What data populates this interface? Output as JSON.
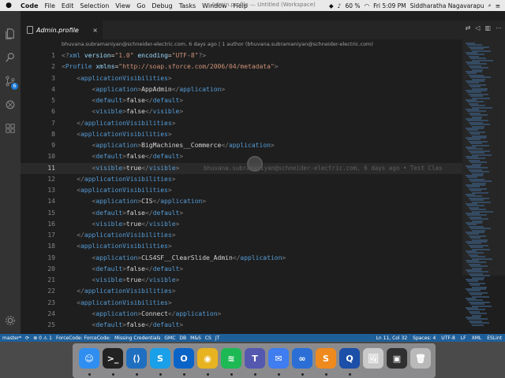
{
  "menubar": {
    "apple_icon": "apple-icon",
    "items": [
      "Code",
      "File",
      "Edit",
      "Selection",
      "View",
      "Go",
      "Debug",
      "Tasks",
      "Window",
      "Help"
    ],
    "window_title": "Admin.profile — Untitled (Workspace)",
    "battery": "60 %",
    "clock": "Fri 5:09 PM",
    "user": "Siddharatha Nagavarapu"
  },
  "activity_bar": {
    "icons": [
      "files-icon",
      "search-icon",
      "source-control-icon",
      "debug-icon",
      "extensions-icon"
    ],
    "scm_badge": "6",
    "settings_icon": "gear-icon"
  },
  "tab": {
    "label": "Admin.profile",
    "close": "×"
  },
  "editor": {
    "blame_header": "bhuvana.subramaniyan@schneider-electric.com, 6 days ago | 1 author (bhuvana.subramaniyan@schneider-electric.com)",
    "inline_blame": "bhuvana.subramaniyan@schneider-electric.com, 6 days ago • Test Clas",
    "current_line": "11",
    "lines": [
      {
        "n": "1",
        "i": 0,
        "tok": [
          [
            "p",
            "<?"
          ],
          [
            "t",
            "xml"
          ],
          [
            "a",
            " version"
          ],
          [
            "x",
            "="
          ],
          [
            "s",
            "\"1.0\""
          ],
          [
            "a",
            " encoding"
          ],
          [
            "x",
            "="
          ],
          [
            "s",
            "\"UTF-8\""
          ],
          [
            "p",
            "?>"
          ]
        ]
      },
      {
        "n": "2",
        "i": 0,
        "tok": [
          [
            "p",
            "<"
          ],
          [
            "t",
            "Profile"
          ],
          [
            "a",
            " xmlns"
          ],
          [
            "x",
            "="
          ],
          [
            "s",
            "\"http://soap.sforce.com/2006/04/metadata\""
          ],
          [
            "p",
            ">"
          ]
        ]
      },
      {
        "n": "3",
        "i": 1,
        "tok": [
          [
            "p",
            "<"
          ],
          [
            "t",
            "applicationVisibilities"
          ],
          [
            "p",
            ">"
          ]
        ]
      },
      {
        "n": "4",
        "i": 2,
        "tok": [
          [
            "p",
            "<"
          ],
          [
            "t",
            "application"
          ],
          [
            "p",
            ">"
          ],
          [
            "x",
            "AppAdmin"
          ],
          [
            "p",
            "</"
          ],
          [
            "t",
            "application"
          ],
          [
            "p",
            ">"
          ]
        ]
      },
      {
        "n": "5",
        "i": 2,
        "tok": [
          [
            "p",
            "<"
          ],
          [
            "t",
            "default"
          ],
          [
            "p",
            ">"
          ],
          [
            "x",
            "false"
          ],
          [
            "p",
            "</"
          ],
          [
            "t",
            "default"
          ],
          [
            "p",
            ">"
          ]
        ]
      },
      {
        "n": "6",
        "i": 2,
        "tok": [
          [
            "p",
            "<"
          ],
          [
            "t",
            "visible"
          ],
          [
            "p",
            ">"
          ],
          [
            "x",
            "false"
          ],
          [
            "p",
            "</"
          ],
          [
            "t",
            "visible"
          ],
          [
            "p",
            ">"
          ]
        ]
      },
      {
        "n": "7",
        "i": 1,
        "tok": [
          [
            "p",
            "</"
          ],
          [
            "t",
            "applicationVisibilities"
          ],
          [
            "p",
            ">"
          ]
        ]
      },
      {
        "n": "8",
        "i": 1,
        "tok": [
          [
            "p",
            "<"
          ],
          [
            "t",
            "applicationVisibilities"
          ],
          [
            "p",
            ">"
          ]
        ]
      },
      {
        "n": "9",
        "i": 2,
        "tok": [
          [
            "p",
            "<"
          ],
          [
            "t",
            "application"
          ],
          [
            "p",
            ">"
          ],
          [
            "x",
            "BigMachines__Commerce"
          ],
          [
            "p",
            "</"
          ],
          [
            "t",
            "application"
          ],
          [
            "p",
            ">"
          ]
        ]
      },
      {
        "n": "10",
        "i": 2,
        "tok": [
          [
            "p",
            "<"
          ],
          [
            "t",
            "default"
          ],
          [
            "p",
            ">"
          ],
          [
            "x",
            "false"
          ],
          [
            "p",
            "</"
          ],
          [
            "t",
            "default"
          ],
          [
            "p",
            ">"
          ]
        ]
      },
      {
        "n": "11",
        "i": 2,
        "tok": [
          [
            "p",
            "<"
          ],
          [
            "t",
            "visible"
          ],
          [
            "p",
            ">"
          ],
          [
            "x",
            "true"
          ],
          [
            "p",
            "</"
          ],
          [
            "t",
            "visible"
          ],
          [
            "p",
            ">"
          ]
        ]
      },
      {
        "n": "12",
        "i": 1,
        "tok": [
          [
            "p",
            "</"
          ],
          [
            "t",
            "applicationVisibilities"
          ],
          [
            "p",
            ">"
          ]
        ]
      },
      {
        "n": "13",
        "i": 1,
        "tok": [
          [
            "p",
            "<"
          ],
          [
            "t",
            "applicationVisibilities"
          ],
          [
            "p",
            ">"
          ]
        ]
      },
      {
        "n": "14",
        "i": 2,
        "tok": [
          [
            "p",
            "<"
          ],
          [
            "t",
            "application"
          ],
          [
            "p",
            ">"
          ],
          [
            "x",
            "CIS"
          ],
          [
            "p",
            "</"
          ],
          [
            "t",
            "application"
          ],
          [
            "p",
            ">"
          ]
        ]
      },
      {
        "n": "15",
        "i": 2,
        "tok": [
          [
            "p",
            "<"
          ],
          [
            "t",
            "default"
          ],
          [
            "p",
            ">"
          ],
          [
            "x",
            "false"
          ],
          [
            "p",
            "</"
          ],
          [
            "t",
            "default"
          ],
          [
            "p",
            ">"
          ]
        ]
      },
      {
        "n": "16",
        "i": 2,
        "tok": [
          [
            "p",
            "<"
          ],
          [
            "t",
            "visible"
          ],
          [
            "p",
            ">"
          ],
          [
            "x",
            "true"
          ],
          [
            "p",
            "</"
          ],
          [
            "t",
            "visible"
          ],
          [
            "p",
            ">"
          ]
        ]
      },
      {
        "n": "17",
        "i": 1,
        "tok": [
          [
            "p",
            "</"
          ],
          [
            "t",
            "applicationVisibilities"
          ],
          [
            "p",
            ">"
          ]
        ]
      },
      {
        "n": "18",
        "i": 1,
        "tok": [
          [
            "p",
            "<"
          ],
          [
            "t",
            "applicationVisibilities"
          ],
          [
            "p",
            ">"
          ]
        ]
      },
      {
        "n": "19",
        "i": 2,
        "tok": [
          [
            "p",
            "<"
          ],
          [
            "t",
            "application"
          ],
          [
            "p",
            ">"
          ],
          [
            "x",
            "CLS4SF__ClearSlide_Admin"
          ],
          [
            "p",
            "</"
          ],
          [
            "t",
            "application"
          ],
          [
            "p",
            ">"
          ]
        ]
      },
      {
        "n": "20",
        "i": 2,
        "tok": [
          [
            "p",
            "<"
          ],
          [
            "t",
            "default"
          ],
          [
            "p",
            ">"
          ],
          [
            "x",
            "false"
          ],
          [
            "p",
            "</"
          ],
          [
            "t",
            "default"
          ],
          [
            "p",
            ">"
          ]
        ]
      },
      {
        "n": "21",
        "i": 2,
        "tok": [
          [
            "p",
            "<"
          ],
          [
            "t",
            "visible"
          ],
          [
            "p",
            ">"
          ],
          [
            "x",
            "true"
          ],
          [
            "p",
            "</"
          ],
          [
            "t",
            "visible"
          ],
          [
            "p",
            ">"
          ]
        ]
      },
      {
        "n": "22",
        "i": 1,
        "tok": [
          [
            "p",
            "</"
          ],
          [
            "t",
            "applicationVisibilities"
          ],
          [
            "p",
            ">"
          ]
        ]
      },
      {
        "n": "23",
        "i": 1,
        "tok": [
          [
            "p",
            "<"
          ],
          [
            "t",
            "applicationVisibilities"
          ],
          [
            "p",
            ">"
          ]
        ]
      },
      {
        "n": "24",
        "i": 2,
        "tok": [
          [
            "p",
            "<"
          ],
          [
            "t",
            "application"
          ],
          [
            "p",
            ">"
          ],
          [
            "x",
            "Connect"
          ],
          [
            "p",
            "</"
          ],
          [
            "t",
            "application"
          ],
          [
            "p",
            ">"
          ]
        ]
      },
      {
        "n": "25",
        "i": 2,
        "tok": [
          [
            "p",
            "<"
          ],
          [
            "t",
            "default"
          ],
          [
            "p",
            ">"
          ],
          [
            "x",
            "false"
          ],
          [
            "p",
            "</"
          ],
          [
            "t",
            "default"
          ],
          [
            "p",
            ">"
          ]
        ]
      }
    ]
  },
  "status_bar": {
    "left": [
      "master*",
      "⟳",
      "⊗ 0 ⚠ 1",
      "ForceCode: ForceCode:",
      "Missing Credentials",
      "GMC",
      "DB",
      "M&S",
      "CS",
      "JT"
    ],
    "right": [
      "Ln 11, Col 32",
      "Spaces: 4",
      "UTF-8",
      "LF",
      "XML",
      "ESLint"
    ]
  },
  "dock": {
    "apps": [
      {
        "name": "finder",
        "color": "#2f8ef0",
        "glyph": "☺"
      },
      {
        "name": "terminal",
        "color": "#222222",
        "glyph": ">_"
      },
      {
        "name": "vscode",
        "color": "#1f6fc0",
        "glyph": "⟨⟩"
      },
      {
        "name": "skype",
        "color": "#1aa0e8",
        "glyph": "S"
      },
      {
        "name": "outlook",
        "color": "#0a64c8",
        "glyph": "O"
      },
      {
        "name": "chrome",
        "color": "#e8b320",
        "glyph": "◉"
      },
      {
        "name": "spotify",
        "color": "#1db954",
        "glyph": "≋"
      },
      {
        "name": "teams",
        "color": "#5558af",
        "glyph": "T"
      },
      {
        "name": "messenger",
        "color": "#3f7df0",
        "glyph": "✉"
      },
      {
        "name": "loop",
        "color": "#2b6fd6",
        "glyph": "∞"
      },
      {
        "name": "sublime",
        "color": "#ef8a1e",
        "glyph": "S"
      },
      {
        "name": "quicktime",
        "color": "#1b4fa8",
        "glyph": "Q"
      },
      {
        "name": "preview",
        "color": "#c9c9c9",
        "glyph": "🖼"
      },
      {
        "name": "screen",
        "color": "#303030",
        "glyph": "▣"
      },
      {
        "name": "trash",
        "color": "#b9b9b9",
        "glyph": "🗑"
      }
    ]
  }
}
